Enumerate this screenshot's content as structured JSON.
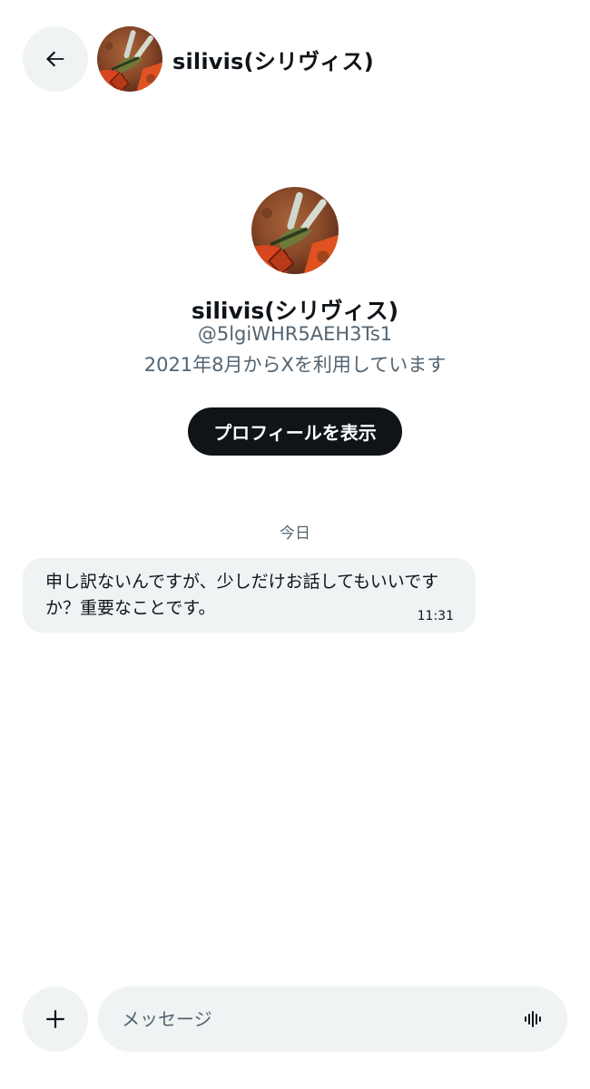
{
  "header": {
    "back_icon": "arrow-left-icon",
    "name": "silivis(シリヴィス)"
  },
  "profile": {
    "name": "silivis(シリヴィス)",
    "handle": "@5lgiWHR5AEH3Ts1",
    "joined": "2021年8月からXを利用しています",
    "view_profile_label": "プロフィールを表示"
  },
  "conversation": {
    "date_label": "今日",
    "messages": [
      {
        "text": "申し訳ないんですが、少しだけお話してもいいですか？重要なことです。",
        "time": "11:31"
      }
    ]
  },
  "composer": {
    "placeholder": "メッセージ",
    "add_icon": "plus-icon",
    "voice_icon": "voice-waveform-icon"
  },
  "colors": {
    "background": "#ffffff",
    "bubble": "#eff3f4",
    "button_dark": "#0f1419",
    "secondary_text": "#536471"
  }
}
